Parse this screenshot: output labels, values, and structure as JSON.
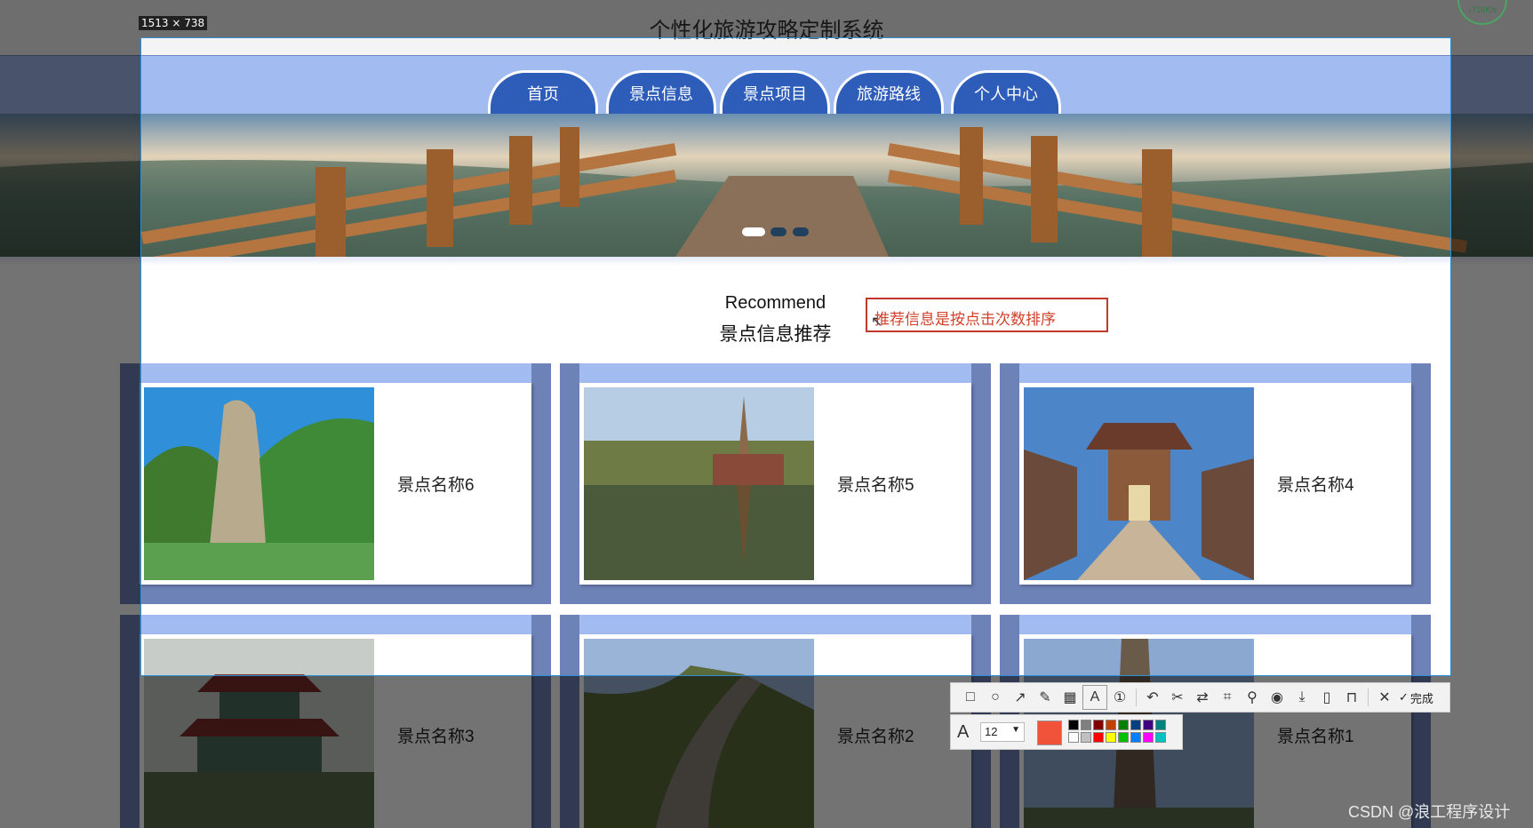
{
  "page": {
    "title": "个性化旅游攻略定制系统"
  },
  "nav": {
    "tabs": [
      {
        "label": "首页"
      },
      {
        "label": "景点信息"
      },
      {
        "label": "景点项目"
      },
      {
        "label": "旅游路线"
      },
      {
        "label": "个人中心"
      }
    ]
  },
  "banner": {
    "slide_count": 3,
    "active_slide": 1
  },
  "recommend": {
    "heading_en": "Recommend",
    "heading_cn": "景点信息推荐",
    "annotation_text": "推荐信息是按点击次数排序"
  },
  "cards": [
    {
      "name": "景点名称6",
      "image": "mountain-river-photo"
    },
    {
      "name": "景点名称5",
      "image": "pagoda-lake-photo"
    },
    {
      "name": "景点名称4",
      "image": "old-town-gate-photo"
    },
    {
      "name": "景点名称3",
      "image": "tower-pavilion-photo"
    },
    {
      "name": "景点名称2",
      "image": "great-wall-photo"
    },
    {
      "name": "景点名称1",
      "image": "stone-pillar-photo"
    }
  ],
  "screenshot_tool": {
    "size_label": "1513 × 738",
    "tools": [
      "rectangle-icon",
      "ellipse-icon",
      "arrow-icon",
      "pencil-icon",
      "mosaic-icon",
      "text-icon",
      "number-icon",
      "undo-icon",
      "cut-icon",
      "translate-icon",
      "ocr-icon",
      "pin-icon",
      "record-icon",
      "download-icon",
      "long-screenshot-icon",
      "save-icon",
      "close-icon"
    ],
    "done_label": "完成",
    "font_size": "12",
    "current_color": "#f0533a",
    "palette": [
      "#000000",
      "#808080",
      "#800000",
      "#c04000",
      "#008000",
      "#004080",
      "#400080",
      "#008080",
      "#ffffff",
      "#c0c0c0",
      "#ff0000",
      "#ffff00",
      "#00c000",
      "#0080ff",
      "#ff00ff",
      "#00c0c0"
    ]
  },
  "network": {
    "speed": "↓716K/s"
  },
  "watermark": "CSDN @浪工程序设计"
}
